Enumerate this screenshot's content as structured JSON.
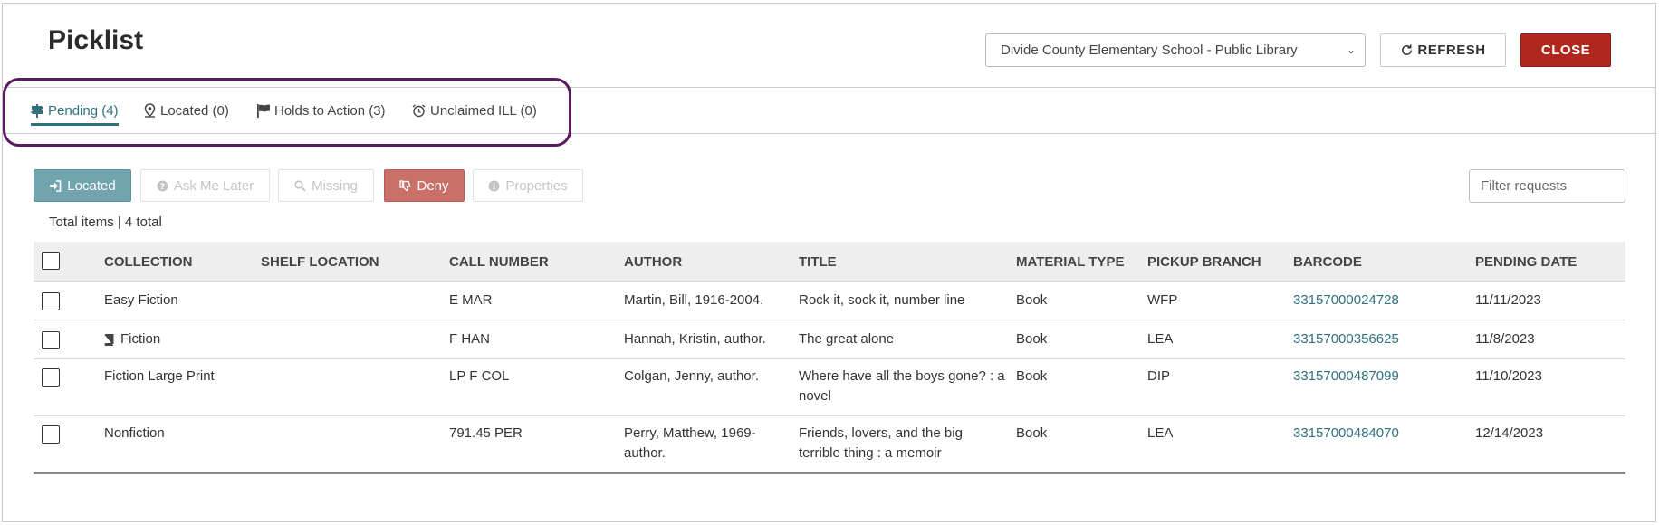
{
  "header": {
    "title": "Picklist",
    "branch_selected": "Divide County Elementary School - Public Library",
    "refresh_label": "REFRESH",
    "close_label": "CLOSE"
  },
  "tabs": [
    {
      "label": "Pending (4)",
      "icon": "signpost-icon",
      "active": true
    },
    {
      "label": "Located (0)",
      "icon": "map-marker-icon",
      "active": false
    },
    {
      "label": "Holds to Action (3)",
      "icon": "flag-icon",
      "active": false
    },
    {
      "label": "Unclaimed ILL (0)",
      "icon": "alarm-clock-icon",
      "active": false
    }
  ],
  "actions": {
    "located": "Located",
    "ask_me_later": "Ask Me Later",
    "missing": "Missing",
    "deny": "Deny",
    "properties": "Properties",
    "filter_placeholder": "Filter requests"
  },
  "total_text": "Total items | 4 total",
  "table": {
    "columns": [
      "COLLECTION",
      "SHELF LOCATION",
      "CALL NUMBER",
      "AUTHOR",
      "TITLE",
      "MATERIAL TYPE",
      "PICKUP BRANCH",
      "BARCODE",
      "PENDING DATE"
    ],
    "rows": [
      {
        "collection": "Easy Fiction",
        "shelf_location": "",
        "call_number": "E MAR",
        "author": "Martin, Bill, 1916-2004.",
        "title": "Rock it, sock it, number line",
        "material_type": "Book",
        "pickup_branch": "WFP",
        "barcode": "33157000024728",
        "pending_date": "11/11/2023"
      },
      {
        "collection": "Fiction",
        "shelf_location": "",
        "call_number": "F HAN",
        "author": "Hannah, Kristin, author.",
        "title": "The great alone",
        "material_type": "Book",
        "pickup_branch": "LEA",
        "barcode": "33157000356625",
        "pending_date": "11/8/2023"
      },
      {
        "collection": "Fiction Large Print",
        "shelf_location": "",
        "call_number": "LP F COL",
        "author": "Colgan, Jenny, author.",
        "title": "Where have all the boys gone? : a novel",
        "material_type": "Book",
        "pickup_branch": "DIP",
        "barcode": "33157000487099",
        "pending_date": "11/10/2023"
      },
      {
        "collection": "Nonfiction",
        "shelf_location": "",
        "call_number": "791.45 PER",
        "author": "Perry, Matthew, 1969- author.",
        "title": "Friends, lovers, and the big terrible thing : a memoir",
        "material_type": "Book",
        "pickup_branch": "LEA",
        "barcode": "33157000484070",
        "pending_date": "12/14/2023"
      }
    ]
  },
  "colors": {
    "accent": "#2f7180",
    "close": "#b0271e",
    "deny": "#c97069",
    "located": "#72a4b0",
    "highlight": "#5a1a5f"
  }
}
